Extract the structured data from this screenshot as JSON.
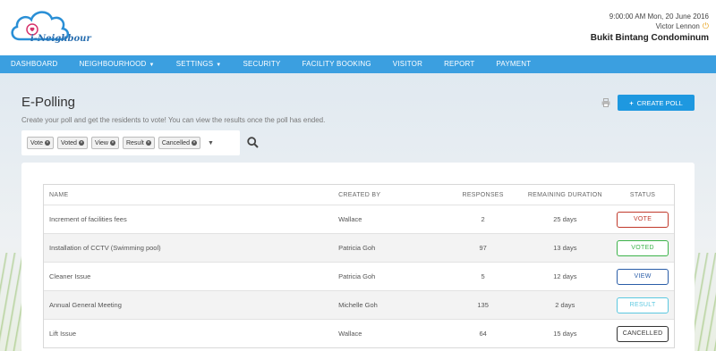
{
  "header": {
    "logo_text": "i-Neighbour",
    "datetime": "9:00:00 AM Mon, 20 June 2016",
    "user": "Victor Lennon",
    "condominium": "Bukit Bintang Condominum"
  },
  "nav": {
    "items": [
      {
        "label": "DASHBOARD"
      },
      {
        "label": "NEIGHBOURHOOD",
        "dropdown": true
      },
      {
        "label": "SETTINGS",
        "dropdown": true
      },
      {
        "label": "SECURITY"
      },
      {
        "label": "FACILITY BOOKING"
      },
      {
        "label": "VISITOR"
      },
      {
        "label": "REPORT"
      },
      {
        "label": "PAYMENT"
      }
    ]
  },
  "page": {
    "title": "E-Polling",
    "subtitle": "Create your poll and get the residents to vote! You can view the results once the poll has ended.",
    "create_button": "CREATE POLL"
  },
  "filters": {
    "chips": [
      "Vote",
      "Voted",
      "View",
      "Result",
      "Cancelled"
    ]
  },
  "table": {
    "headers": {
      "name": "NAME",
      "created_by": "CREATED BY",
      "responses": "RESPONSES",
      "remaining": "REMAINING DURATION",
      "status": "STATUS"
    },
    "rows": [
      {
        "name": "Increment of facilities fees",
        "created_by": "Wallace",
        "responses": "2",
        "remaining": "25 days",
        "status": "VOTE",
        "color": "#c0392b"
      },
      {
        "name": "Installation of CCTV (Swimming pool)",
        "created_by": "Patricia Goh",
        "responses": "97",
        "remaining": "13 days",
        "status": "VOTED",
        "color": "#3cb34a"
      },
      {
        "name": "Cleaner Issue",
        "created_by": "Patricia Goh",
        "responses": "5",
        "remaining": "12 days",
        "status": "VIEW",
        "color": "#2a5da8"
      },
      {
        "name": "Annual General Meeting",
        "created_by": "Michelle Goh",
        "responses": "135",
        "remaining": "2 days",
        "status": "RESULT",
        "color": "#5bc8e0"
      },
      {
        "name": "Lift Issue",
        "created_by": "Wallace",
        "responses": "64",
        "remaining": "15 days",
        "status": "CANCELLED",
        "color": "#333333"
      }
    ]
  },
  "colors": {
    "nav": "#3b9fe0",
    "primary_button": "#1e98e0"
  }
}
